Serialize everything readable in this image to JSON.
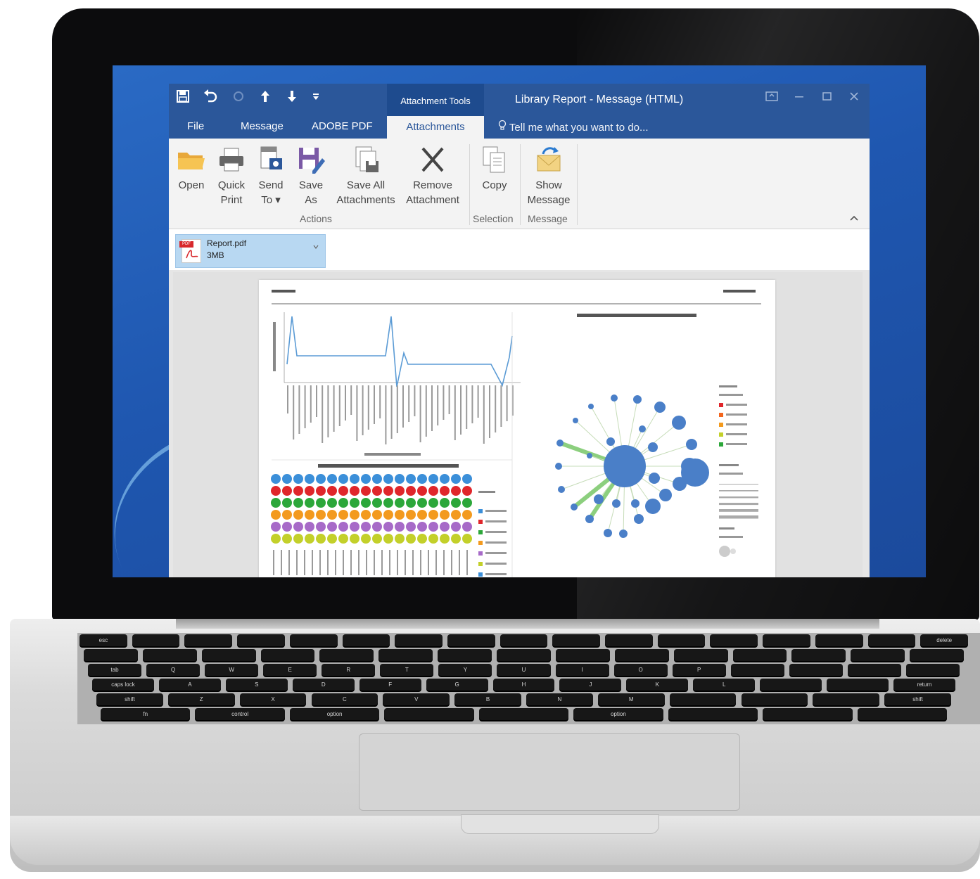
{
  "window": {
    "title": "Library Report - Message (HTML)",
    "context_tab": "Attachment Tools",
    "quick_access": [
      "save-icon",
      "undo-icon",
      "redo-icon",
      "up-arrow-icon",
      "down-arrow-icon",
      "customize-icon"
    ],
    "controls": [
      "restore-ribbon-icon",
      "minimize-icon",
      "maximize-icon",
      "close-icon"
    ]
  },
  "ribbon": {
    "tabs": [
      {
        "label": "File"
      },
      {
        "label": "Message"
      },
      {
        "label": "ADOBE PDF"
      },
      {
        "label": "Attachments",
        "active": true
      }
    ],
    "tell_me": "Tell me what you want to do...",
    "groups": [
      {
        "label": "Actions",
        "buttons": [
          {
            "line1": "Open",
            "line2": "",
            "icon": "folder-icon"
          },
          {
            "line1": "Quick",
            "line2": "Print",
            "icon": "printer-icon"
          },
          {
            "line1": "Send",
            "line2": "To ▾",
            "icon": "send-to-icon"
          },
          {
            "line1": "Save",
            "line2": "As",
            "icon": "save-as-icon"
          },
          {
            "line1": "Save All",
            "line2": "Attachments",
            "icon": "save-all-icon"
          },
          {
            "line1": "Remove",
            "line2": "Attachment",
            "icon": "remove-icon"
          }
        ]
      },
      {
        "label": "Selection",
        "buttons": [
          {
            "line1": "Copy",
            "line2": "",
            "icon": "copy-icon"
          }
        ]
      },
      {
        "label": "Message",
        "buttons": [
          {
            "line1": "Show",
            "line2": "Message",
            "icon": "show-message-icon"
          }
        ]
      }
    ]
  },
  "attachment": {
    "name": "Report.pdf",
    "size": "3MB",
    "icon": "pdf-file-icon"
  },
  "colors": {
    "outlook_blue": "#2b579a",
    "selected_attachment": "#b8d8f2",
    "chart_line": "#5b9bd5",
    "network_node": "#4a7fc8",
    "network_edge": "#8ccf7e"
  },
  "keyboard": {
    "row1": [
      "esc",
      "",
      "",
      "",
      "",
      "",
      "",
      "",
      "",
      "",
      "",
      "",
      "",
      "",
      "",
      "",
      "delete"
    ],
    "row2": [
      "",
      "",
      "",
      "",
      "",
      "",
      "",
      "",
      "",
      "",
      "",
      "",
      "",
      "",
      ""
    ],
    "row3": [
      "tab",
      "Q",
      "W",
      "E",
      "R",
      "T",
      "Y",
      "U",
      "I",
      "O",
      "P",
      "",
      "",
      "",
      ""
    ],
    "row4": [
      "caps lock",
      "A",
      "S",
      "D",
      "F",
      "G",
      "H",
      "J",
      "K",
      "L",
      "",
      "",
      "return"
    ],
    "row5": [
      "shift",
      "Z",
      "X",
      "C",
      "V",
      "B",
      "N",
      "M",
      "",
      "",
      "",
      "shift"
    ],
    "row6": [
      "fn",
      "control",
      "option",
      "",
      "",
      "option",
      "",
      "",
      ""
    ]
  }
}
